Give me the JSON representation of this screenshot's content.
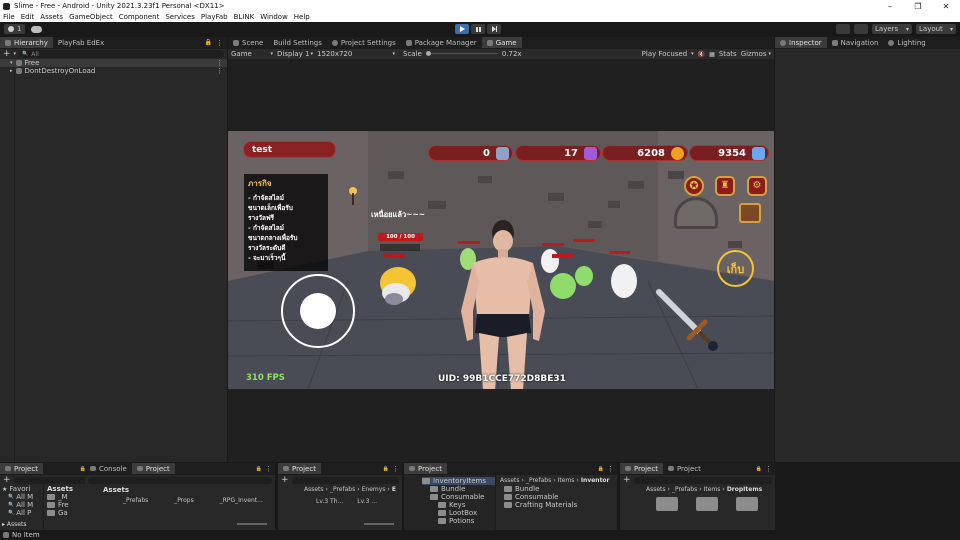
{
  "window": {
    "title": "Slime - Free - Android - Unity 2021.3.23f1 Personal <DX11>",
    "controls": [
      "–",
      "❐",
      "✕"
    ]
  },
  "menu": [
    "File",
    "Edit",
    "Assets",
    "GameObject",
    "Component",
    "Services",
    "PlayFab",
    "BLINK",
    "Window",
    "Help"
  ],
  "toolbar": {
    "account": "1",
    "layers": "Layers",
    "layout": "Layout"
  },
  "hierarchy": {
    "tabs": [
      "Hierarchy",
      "PlayFab EdEx"
    ],
    "search_placeholder": "All",
    "items": [
      "Free",
      "DontDestroyOnLoad"
    ]
  },
  "center_tabs": [
    "Scene",
    "Build Settings",
    "Project Settings",
    "Package Manager",
    "Game"
  ],
  "game_toolbar": {
    "view": "Game",
    "display": "Display 1",
    "resolution": "1520x720",
    "scale_label": "Scale",
    "scale_value": "0.72x",
    "play_mode": "Play Focused",
    "stats": "Stats",
    "gizmos": "Gizmos"
  },
  "right_tabs": [
    "Inspector",
    "Navigation",
    "Lighting"
  ],
  "game": {
    "player_name": "test",
    "currencies": [
      "0",
      "17",
      "6208",
      "9354"
    ],
    "quest_title": "ภารกิจ",
    "quest_lines": [
      "- กำจัดสไลม์",
      "ขนาดเล็กเพื่อรับ",
      "รางวัลฟรี",
      "- กำจัดสไลม์",
      "ขนาดกลางเพื่อรับ",
      "รางวัลระดับดี",
      "- จะมาเร็วๆนี้"
    ],
    "player_caption": "เหนื่อยแล้ว~~~",
    "hp": "100 / 100",
    "fps": "310 FPS",
    "uid": "UID: 99B1CCE772D8BE31",
    "collect_button": "เก็บ"
  },
  "bottom_panels": [
    {
      "tabs": [
        "Project"
      ],
      "favorites": "Favori",
      "fav_items": [
        "All M",
        "All M",
        "All P"
      ],
      "assets_label": "Assets",
      "asset_items": [
        "_M",
        "Fre",
        "Ga"
      ]
    },
    {
      "tabs": [
        "Console",
        "Project"
      ],
      "breadcrumb": "Assets",
      "items": [
        "_Prefabs",
        "_Props",
        "_RPG_Invent..."
      ]
    },
    {
      "tabs": [
        "Project"
      ],
      "breadcrumb": [
        "Assets",
        "_Prefabs",
        "Enemys",
        "E"
      ],
      "items": [
        "Lv.3 Th...",
        "Lv.3 ..."
      ]
    },
    {
      "tabs": [
        "Project"
      ],
      "tree": [
        "InventoryItems",
        "Bundle",
        "Consumable",
        "Keys",
        "LootBox",
        "Potions"
      ],
      "breadcrumb": [
        "Assets",
        "_Prefabs",
        "Items",
        "Inventor"
      ],
      "items": [
        "Bundle",
        "Consumable",
        "Crafting Materials"
      ]
    },
    {
      "tabs": [
        "Project",
        "Project"
      ],
      "breadcrumb": [
        "Assets",
        "_Prefabs",
        "Items",
        "DropItems"
      ]
    }
  ],
  "status_bar": "No Item"
}
